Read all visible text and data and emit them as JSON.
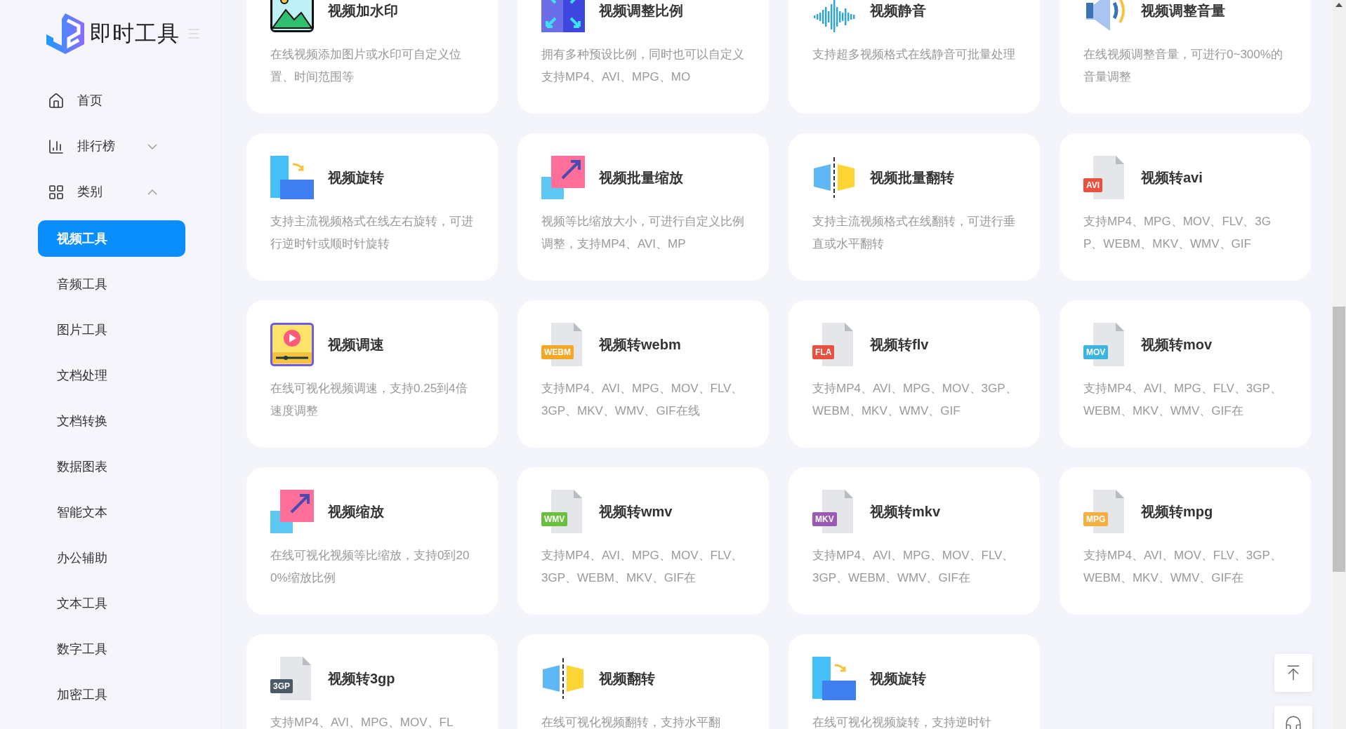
{
  "logo": {
    "title": "即时工具"
  },
  "nav": [
    {
      "kind": "home",
      "label": "首页"
    },
    {
      "kind": "ranking",
      "label": "排行榜",
      "expanded": false
    },
    {
      "kind": "category",
      "label": "类别",
      "expanded": true
    }
  ],
  "categories": [
    {
      "label": "视频工具",
      "selected": true
    },
    {
      "label": "音频工具",
      "selected": false
    },
    {
      "label": "图片工具",
      "selected": false
    },
    {
      "label": "文档处理",
      "selected": false
    },
    {
      "label": "文档转换",
      "selected": false
    },
    {
      "label": "数据图表",
      "selected": false
    },
    {
      "label": "智能文本",
      "selected": false
    },
    {
      "label": "办公辅助",
      "selected": false
    },
    {
      "label": "文本工具",
      "selected": false
    },
    {
      "label": "数字工具",
      "selected": false
    },
    {
      "label": "加密工具",
      "selected": false
    }
  ],
  "tools": [
    {
      "kind": "watermark",
      "title": "视频加水印",
      "description": "在线视频添加图片或水印可自定义位置、时间范围等"
    },
    {
      "kind": "ratio",
      "title": "视频调整比例",
      "description": "拥有多种预设比例，同时也可以自定义支持MP4、AVI、MPG、MO"
    },
    {
      "kind": "mute",
      "title": "视频静音",
      "description": "支持超多视频格式在线静音可批量处理"
    },
    {
      "kind": "volume",
      "title": "视频调整音量",
      "description": "在线视频调整音量，可进行0~300%的音量调整"
    },
    {
      "kind": "rotate",
      "title": "视频旋转",
      "description": "支持主流视频格式在线左右旋转，可进行逆时针或顺时针旋转"
    },
    {
      "kind": "scale",
      "title": "视频批量缩放",
      "description": "视频等比缩放大小，可进行自定义比例调整，支持MP4、AVI、MP"
    },
    {
      "kind": "flip",
      "title": "视频批量翻转",
      "description": "支持主流视频格式在线翻转，可进行垂直或水平翻转"
    },
    {
      "kind": "file",
      "badge": "AVI",
      "color": "#e8503f",
      "title": "视频转avi",
      "description": "支持MP4、MPG、MOV、FLV、3GP、WEBM、MKV、WMV、GIF"
    },
    {
      "kind": "speed",
      "title": "视频调速",
      "description": "在线可视化视频调速，支持0.25到4倍速度调整"
    },
    {
      "kind": "file",
      "badge": "WEBM",
      "color": "#f5a623",
      "title": "视频转webm",
      "description": "支持MP4、AVI、MPG、MOV、FLV、3GP、MKV、WMV、GIF在线"
    },
    {
      "kind": "file",
      "badge": "FLA",
      "color": "#e8503f",
      "title": "视频转flv",
      "description": "支持MP4、AVI、MPG、MOV、3GP、WEBM、MKV、WMV、GIF"
    },
    {
      "kind": "file",
      "badge": "MOV",
      "color": "#3bb4e0",
      "title": "视频转mov",
      "description": "支持MP4、AVI、MPG、FLV、3GP、WEBM、MKV、WMV、GIF在"
    },
    {
      "kind": "scale",
      "title": "视频缩放",
      "description": "在线可视化视频等比缩放，支持0到200%缩放比例"
    },
    {
      "kind": "file",
      "badge": "WMV",
      "color": "#6bbf3f",
      "title": "视频转wmv",
      "description": "支持MP4、AVI、MPG、MOV、FLV、3GP、WEBM、MKV、GIF在"
    },
    {
      "kind": "file",
      "badge": "MKV",
      "color": "#9b59b6",
      "title": "视频转mkv",
      "description": "支持MP4、AVI、MPG、MOV、FLV、3GP、WEBM、WMV、GIF在"
    },
    {
      "kind": "file",
      "badge": "MPG",
      "color": "#f5b041",
      "title": "视频转mpg",
      "description": "支持MP4、AVI、MOV、FLV、3GP、WEBM、MKV、WMV、GIF在"
    },
    {
      "kind": "file",
      "badge": "3GP",
      "color": "#4a5a66",
      "title": "视频转3gp",
      "description": "支持MP4、AVI、MPG、MOV、FL"
    },
    {
      "kind": "flip",
      "title": "视频翻转",
      "description": "在线可视化视频翻转，支持水平翻"
    },
    {
      "kind": "rotate",
      "title": "视频旋转",
      "description": "在线可视化视频旋转，支持逆时针"
    }
  ]
}
